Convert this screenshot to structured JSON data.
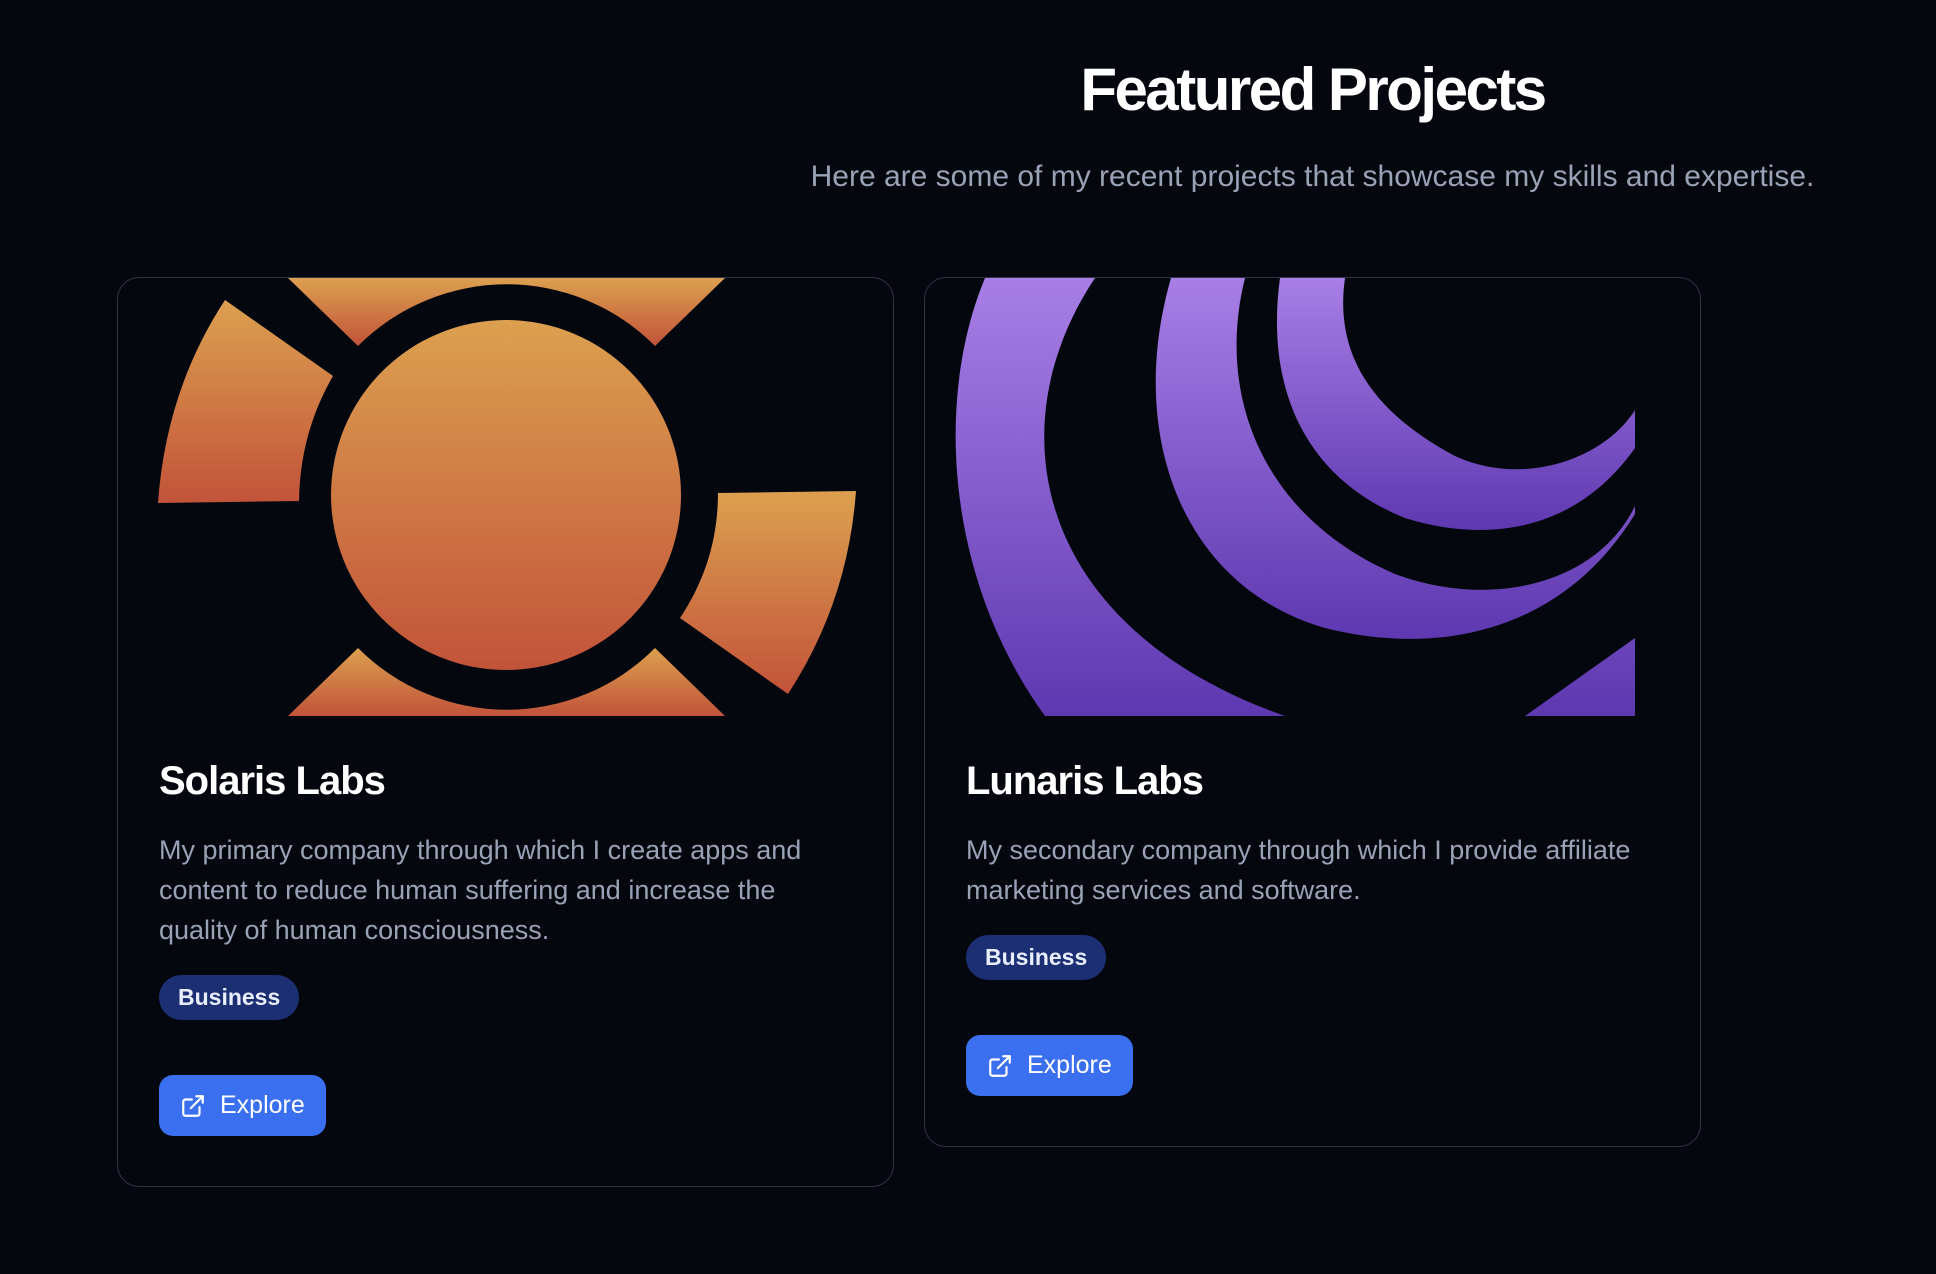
{
  "header": {
    "title": "Featured Projects",
    "subtitle": "Here are some of my recent projects that showcase my skills and expertise."
  },
  "projects": [
    {
      "name": "Solaris Labs",
      "description": "My primary company through which I create apps and content to reduce human suffering and increase the quality of human consciousness.",
      "tag": "Business",
      "button_label": "Explore",
      "button_icon": "external-link-icon",
      "image_icon": "sun-logo",
      "colors": {
        "gradient_top": "#dca04f",
        "gradient_bottom": "#c2533a"
      }
    },
    {
      "name": "Lunaris Labs",
      "description": "My secondary company through which I provide affiliate marketing services and software.",
      "tag": "Business",
      "button_label": "Explore",
      "button_icon": "external-link-icon",
      "image_icon": "moon-crescent-logo",
      "colors": {
        "gradient_top": "#a87ee6",
        "gradient_bottom": "#5e38b0"
      }
    }
  ],
  "colors": {
    "background": "#05070f",
    "accent": "#3a6ff0",
    "tag_background": "#1b2f72",
    "card_border": "#2e3545",
    "muted_text": "#9aa2b6"
  }
}
